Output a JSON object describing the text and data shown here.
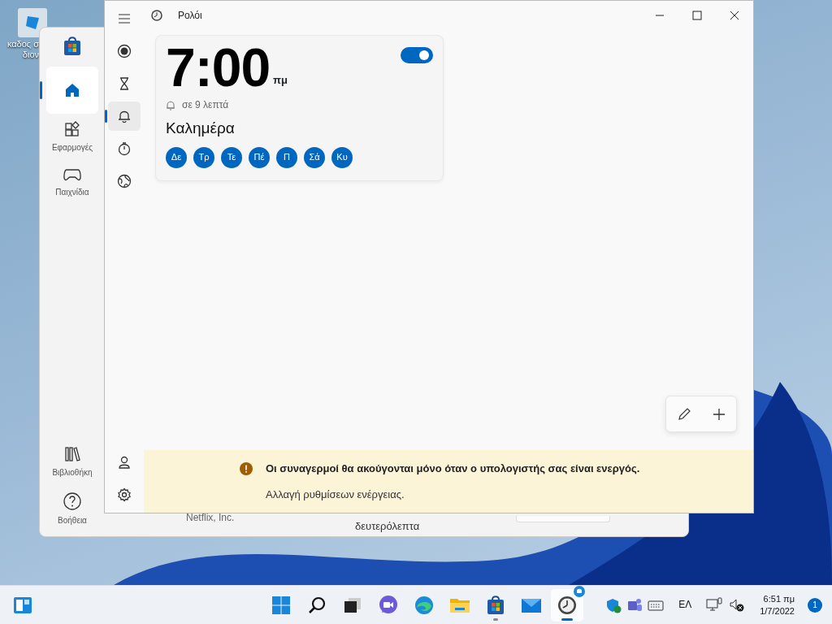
{
  "desktop": {
    "icon_label": [
      "καδος σ",
      "διον"
    ]
  },
  "store_window": {
    "sidebar": [
      {
        "kind": "home",
        "selected": true
      },
      {
        "kind": "apps",
        "label": "Εφαρμογές",
        "selected": false
      },
      {
        "kind": "games",
        "label": "Παιχνίδια",
        "selected": false
      },
      {
        "kind": "library",
        "label": "Βιβλιοθήκη",
        "selected": false
      },
      {
        "kind": "help",
        "label": "Βοήθεια",
        "selected": false
      }
    ],
    "content": {
      "publisher": "Netflix, Inc.",
      "duration": "δευτερόλεπτα"
    }
  },
  "clock_window": {
    "title": "Ρολόι",
    "nav": [
      {
        "kind": "focus",
        "selected": false
      },
      {
        "kind": "timer",
        "selected": false
      },
      {
        "kind": "alarm",
        "selected": true
      },
      {
        "kind": "stopwatch",
        "selected": false
      },
      {
        "kind": "world",
        "selected": false
      }
    ],
    "nav_bottom": [
      {
        "kind": "account"
      },
      {
        "kind": "settings"
      }
    ],
    "alarm": {
      "time": "7:00",
      "period": "πμ",
      "countdown": "σε 9 λεπτά",
      "name": "Καλημέρα",
      "on": true,
      "days": [
        {
          "label": "Δε",
          "selected": true
        },
        {
          "label": "Τρ",
          "selected": true
        },
        {
          "label": "Τε",
          "selected": true
        },
        {
          "label": "Πέ",
          "selected": true
        },
        {
          "label": "Π",
          "selected": true
        },
        {
          "label": "Σά",
          "selected": true
        },
        {
          "label": "Κυ",
          "selected": true
        }
      ]
    },
    "banner": {
      "message": "Οι συναγερμοί θα ακούγονται μόνο όταν ο υπολογιστής σας είναι ενεργός.",
      "link": "Αλλαγή ρυθμίσεων ενέργειας."
    }
  },
  "taskbar": {
    "apps": [
      {
        "kind": "start",
        "running": false,
        "selected": false
      },
      {
        "kind": "search",
        "running": false,
        "selected": false
      },
      {
        "kind": "taskview",
        "running": false,
        "selected": false
      },
      {
        "kind": "chat",
        "running": false,
        "selected": false
      },
      {
        "kind": "edge",
        "running": false,
        "selected": false
      },
      {
        "kind": "explorer",
        "running": false,
        "selected": false
      },
      {
        "kind": "store",
        "running": true,
        "selected": false
      },
      {
        "kind": "mail",
        "running": false,
        "selected": false
      },
      {
        "kind": "clock",
        "running": true,
        "selected": true
      }
    ],
    "tray": {
      "language": "ΕΛ",
      "time": "6:51 πμ",
      "date": "1/7/2022",
      "notifications": "1"
    }
  }
}
